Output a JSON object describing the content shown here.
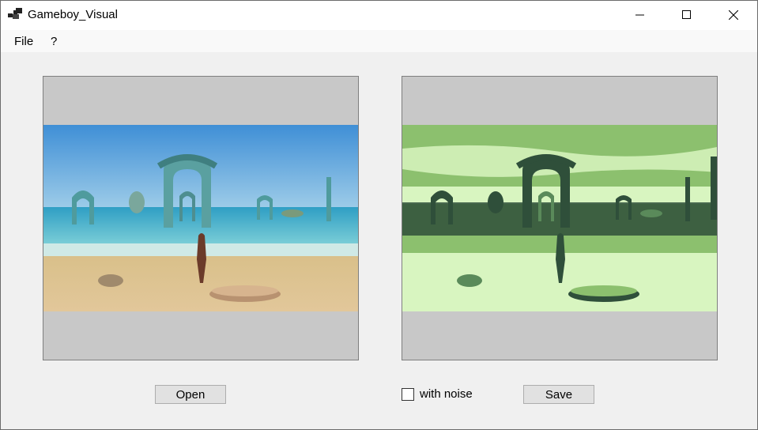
{
  "window": {
    "title": "Gameboy_Visual",
    "icons": {
      "app": "app-windows-icon",
      "minimize": "minimize-icon",
      "maximize": "maximize-icon",
      "close": "close-icon"
    }
  },
  "menu": {
    "items": [
      "File",
      "?"
    ]
  },
  "left_panel": {
    "image": "original-beach-arches-painting"
  },
  "right_panel": {
    "image": "gameboy-green-palette-converted-painting"
  },
  "controls": {
    "open_label": "Open",
    "noise_label": "with noise",
    "noise_checked": false,
    "save_label": "Save"
  },
  "colors": {
    "picture_box_bg": "#c8c8c8",
    "gb_darkest": "#2f4f3a",
    "gb_dark": "#5a8a5a",
    "gb_light": "#8cc06e",
    "gb_lightest": "#d8f5c0"
  }
}
